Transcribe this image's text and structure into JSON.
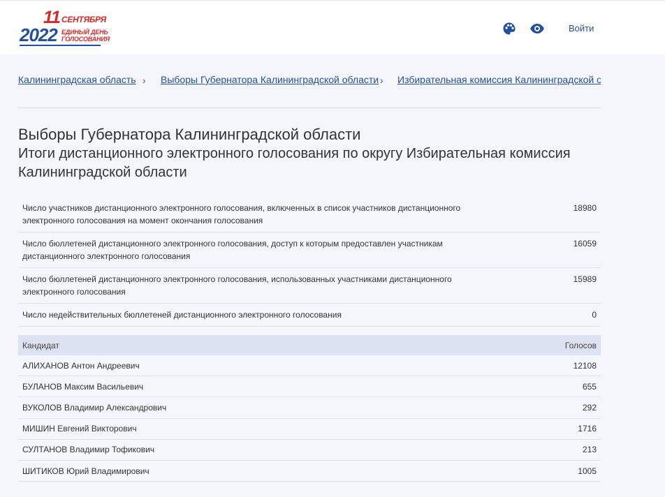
{
  "logo": {
    "day": "11",
    "month": "СЕНТЯБРЯ",
    "year": "2022",
    "line1": "ЕДИНЫЙ ДЕНЬ",
    "line2": "ГОЛОСОВАНИЯ"
  },
  "header": {
    "palette_icon": "palette-icon",
    "eye_icon": "eye-icon",
    "login_label": "Войти",
    "accent_color": "#24509a"
  },
  "breadcrumb": [
    {
      "label": "Калининградская область"
    },
    {
      "label": "Выборы Губернатора Калининградской области"
    },
    {
      "label": "Избирательная комиссия Калининградской об"
    }
  ],
  "title": "Выборы Губернатора Калининградской области",
  "subtitle": "Итоги дистанционного электронного голосования по округу Избирательная комиссия Калининградской области",
  "stats": [
    {
      "label": "Число участников дистанционного электронного голосования, включенных в список участников дистанционного электронного голосования на момент окончания голосования",
      "value": "18980"
    },
    {
      "label": "Число бюллетеней дистанционного электронного голосования, доступ к которым предоставлен участникам дистанционного электронного голосования",
      "value": "16059"
    },
    {
      "label": "Число бюллетеней дистанционного электронного голосования, использованных участниками дистанционного электронного голосования",
      "value": "15989"
    },
    {
      "label": "Число недействительных бюллетеней дистанционного электронного голосования",
      "value": "0"
    }
  ],
  "candidates": {
    "header_name": "Кандидат",
    "header_votes": "Голосов",
    "rows": [
      {
        "name": "АЛИХАНОВ Антон Андреевич",
        "votes": "12108"
      },
      {
        "name": "БУЛАНОВ Максим Васильевич",
        "votes": "655"
      },
      {
        "name": "ВУКОЛОВ Владимир Александрович",
        "votes": "292"
      },
      {
        "name": "МИШИН Евгений Викторович",
        "votes": "1716"
      },
      {
        "name": "СУЛТАНОВ Владимир Тофикович",
        "votes": "213"
      },
      {
        "name": "ШИТИКОВ Юрий Владимирович",
        "votes": "1005"
      }
    ]
  }
}
